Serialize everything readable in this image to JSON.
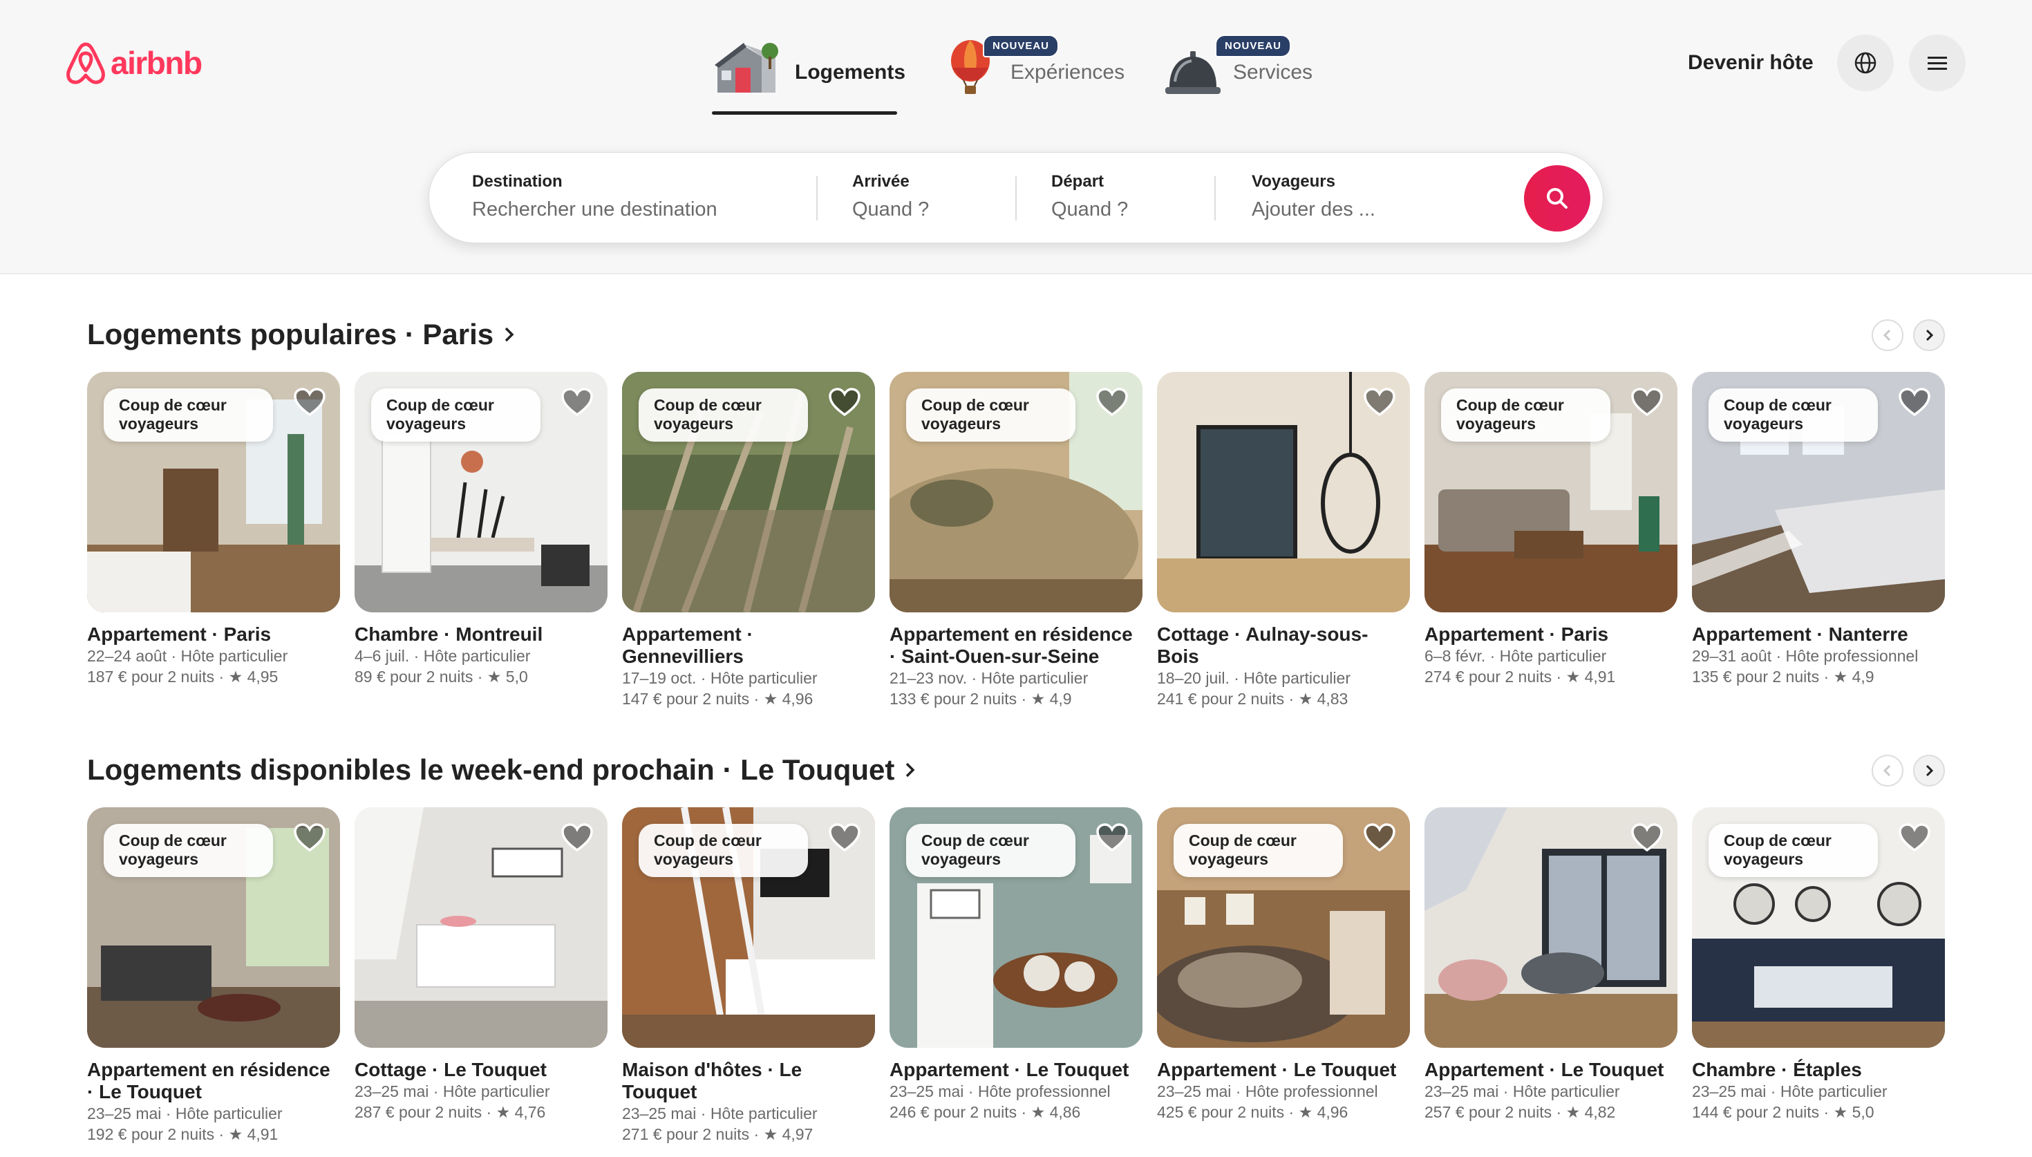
{
  "brand": {
    "name": "airbnb",
    "color": "#ff385c"
  },
  "nav": {
    "tabs": [
      {
        "label": "Logements",
        "icon": "house-icon",
        "active": true
      },
      {
        "label": "Expériences",
        "icon": "hot-air-balloon-icon",
        "badge": "NOUVEAU"
      },
      {
        "label": "Services",
        "icon": "service-bell-icon",
        "badge": "NOUVEAU"
      }
    ],
    "host_link": "Devenir hôte",
    "globe_icon": "globe-icon",
    "menu_icon": "menu-icon"
  },
  "search": {
    "destination": {
      "label": "Destination",
      "placeholder": "Rechercher une destination"
    },
    "arrival": {
      "label": "Arrivée",
      "placeholder": "Quand ?"
    },
    "departure": {
      "label": "Départ",
      "placeholder": "Quand ?"
    },
    "guests": {
      "label": "Voyageurs",
      "placeholder": "Ajouter des ..."
    },
    "button_icon": "search-icon"
  },
  "sections": [
    {
      "title": "Logements populaires · Paris",
      "listings": [
        {
          "badge": "Coup de cœur voyageurs",
          "title": "Appartement · Paris",
          "dates_host": "22–24 août · Hôte particulier",
          "price_rating": "187 € pour 2 nuits · ★ 4,95"
        },
        {
          "badge": "Coup de cœur voyageurs",
          "title": "Chambre · Montreuil",
          "dates_host": "4–6 juil. · Hôte particulier",
          "price_rating": "89 € pour 2 nuits · ★ 5,0"
        },
        {
          "badge": "Coup de cœur voyageurs",
          "title": "Appartement · Gennevilliers",
          "dates_host": "17–19 oct. · Hôte particulier",
          "price_rating": "147 € pour 2 nuits · ★ 4,96"
        },
        {
          "badge": "Coup de cœur voyageurs",
          "title": "Appartement en résidence · Saint-Ouen-sur-Seine",
          "dates_host": "21–23 nov. · Hôte particulier",
          "price_rating": "133 € pour 2 nuits · ★ 4,9"
        },
        {
          "badge": "",
          "title": "Cottage · Aulnay-sous-Bois",
          "dates_host": "18–20 juil. · Hôte particulier",
          "price_rating": "241 € pour 2 nuits · ★ 4,83"
        },
        {
          "badge": "Coup de cœur voyageurs",
          "title": "Appartement · Paris",
          "dates_host": "6–8 févr. · Hôte particulier",
          "price_rating": "274 € pour 2 nuits · ★ 4,91"
        },
        {
          "badge": "Coup de cœur voyageurs",
          "title": "Appartement · Nanterre",
          "dates_host": "29–31 août · Hôte professionnel",
          "price_rating": "135 € pour 2 nuits · ★ 4,9"
        }
      ]
    },
    {
      "title": "Logements disponibles le week-end prochain · Le Touquet",
      "listings": [
        {
          "badge": "Coup de cœur voyageurs",
          "title": "Appartement en résidence · Le Touquet",
          "dates_host": "23–25 mai · Hôte particulier",
          "price_rating": "192 € pour 2 nuits · ★ 4,91"
        },
        {
          "badge": "",
          "title": "Cottage · Le Touquet",
          "dates_host": "23–25 mai · Hôte particulier",
          "price_rating": "287 € pour 2 nuits · ★ 4,76"
        },
        {
          "badge": "Coup de cœur voyageurs",
          "title": "Maison d'hôtes · Le Touquet",
          "dates_host": "23–25 mai · Hôte particulier",
          "price_rating": "271 € pour 2 nuits · ★ 4,97"
        },
        {
          "badge": "Coup de cœur voyageurs",
          "title": "Appartement · Le Touquet",
          "dates_host": "23–25 mai · Hôte professionnel",
          "price_rating": "246 € pour 2 nuits · ★ 4,86"
        },
        {
          "badge": "Coup de cœur voyageurs",
          "title": "Appartement · Le Touquet",
          "dates_host": "23–25 mai · Hôte professionnel",
          "price_rating": "425 € pour 2 nuits · ★ 4,96"
        },
        {
          "badge": "",
          "title": "Appartement · Le Touquet",
          "dates_host": "23–25 mai · Hôte particulier",
          "price_rating": "257 € pour 2 nuits · ★ 4,82"
        },
        {
          "badge": "Coup de cœur voyageurs",
          "title": "Chambre · Étaples",
          "dates_host": "23–25 mai · Hôte particulier",
          "price_rating": "144 € pour 2 nuits · ★ 5,0"
        }
      ]
    }
  ]
}
